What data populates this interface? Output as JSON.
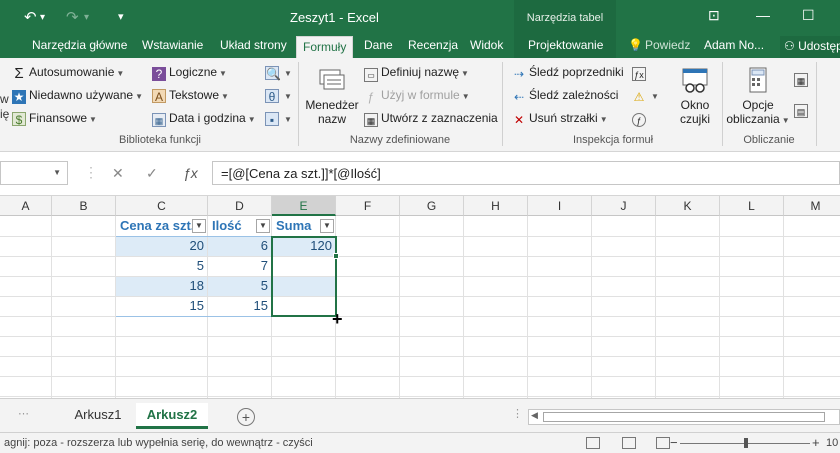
{
  "titlebar": {
    "title": "Zeszyt1 - Excel",
    "tools_header": "Narzędzia tabel",
    "undo_icon": "undo-icon",
    "redo_icon": "redo-icon"
  },
  "tabs": [
    {
      "label": "Narzędzia główne"
    },
    {
      "label": "Wstawianie"
    },
    {
      "label": "Układ strony"
    },
    {
      "label": "Formuły"
    },
    {
      "label": "Dane"
    },
    {
      "label": "Recenzja"
    },
    {
      "label": "Widok"
    },
    {
      "label": "Projektowanie"
    },
    {
      "label": "Powiedz"
    },
    {
      "label": "Adam No..."
    },
    {
      "label": "Udostęp"
    }
  ],
  "ribbon": {
    "library": {
      "autosum": "Autosumowanie",
      "recent": "Niedawno używane",
      "financial": "Finansowe",
      "logical": "Logiczne",
      "text": "Tekstowe",
      "datetime": "Data i godzina",
      "partial_label": "w\nię",
      "label": "Biblioteka funkcji"
    },
    "names": {
      "manager": "Menedżer\nnazw",
      "define": "Definiuj nazwę",
      "use": "Użyj w formule",
      "create": "Utwórz z zaznaczenia",
      "label": "Nazwy zdefiniowane"
    },
    "audit": {
      "precedents": "Śledź poprzedniki",
      "dependents": "Śledź zależności",
      "remove": "Usuń strzałki",
      "watch": "Okno\nczujki",
      "label": "Inspekcja formuł"
    },
    "calc": {
      "options": "Opcje\nobliczania",
      "label": "Obliczanie"
    }
  },
  "formulabar": {
    "namebox": "",
    "formula": "=[@[Cena za szt.]]*[@Ilość]"
  },
  "columns": [
    "A",
    "B",
    "C",
    "D",
    "E",
    "F",
    "G",
    "H",
    "I",
    "J",
    "K",
    "L",
    "M"
  ],
  "table": {
    "headers": [
      "Cena za szt.",
      "Ilość",
      "Suma"
    ],
    "rows": [
      [
        "20",
        "6",
        "120"
      ],
      [
        "5",
        "7",
        ""
      ],
      [
        "18",
        "5",
        ""
      ],
      [
        "15",
        "15",
        ""
      ]
    ]
  },
  "sheets": [
    {
      "label": "Arkusz1"
    },
    {
      "label": "Arkusz2"
    }
  ],
  "status": {
    "text": "agnij: poza - rozszerza lub wypełnia serię, do wewnątrz - czyści",
    "zoom": "10"
  }
}
